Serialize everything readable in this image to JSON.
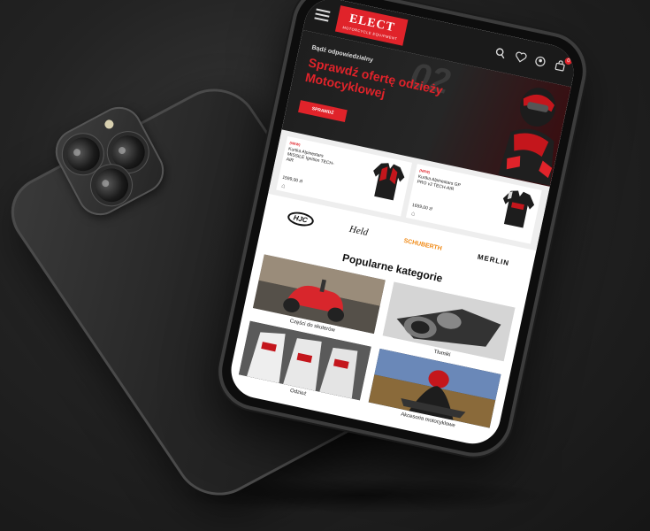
{
  "header": {
    "logo_text": "ELECT",
    "logo_sub": "MOTORCYCLE EQUIPMENT",
    "cart_count": "0",
    "icons": [
      "menu-icon",
      "search-icon",
      "heart-icon",
      "user-icon",
      "cart-icon"
    ]
  },
  "hero": {
    "kicker": "Bądź odpowiedzialny",
    "title": "Sprawdź ofertę odzieży Motocyklowej",
    "button": "SPRAWDŹ",
    "number": "02"
  },
  "products": [
    {
      "tag": "(NEW)",
      "name": "Kurtka Alpinestars MISSILE Ignition TECH-AIR",
      "price": "1599,00 zł"
    },
    {
      "tag": "(NEW)",
      "name": "Kurtka Alpinestars GP PRO v2 TECH-AIR",
      "price": "1659,00 zł"
    }
  ],
  "brands": [
    "HJC",
    "Held",
    "SCHUBERTH",
    "MERLIN"
  ],
  "categories_title": "Popularne kategorie",
  "categories": [
    {
      "label": "Części do skuterów"
    },
    {
      "label": "Tłumiki"
    },
    {
      "label": "Odzież"
    },
    {
      "label": "Akcesoria motocyklowe"
    }
  ],
  "colors": {
    "accent": "#e0232a",
    "dark": "#1a1a1a",
    "schuberth": "#f08a16"
  }
}
